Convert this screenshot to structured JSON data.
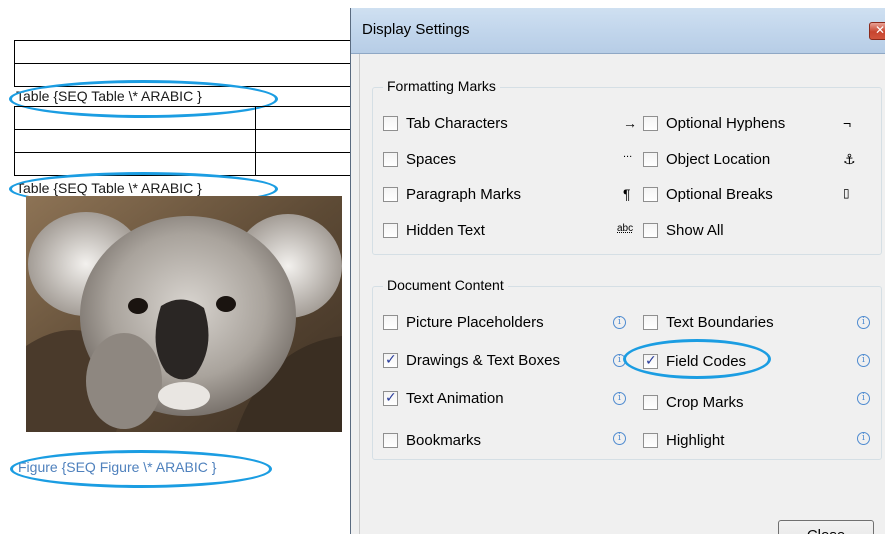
{
  "document": {
    "captions": {
      "table1": "Table {SEQ Table \\* ARABIC }",
      "table2": "Table {SEQ Table \\* ARABIC }",
      "figure": "Figure {SEQ Figure \\* ARABIC }"
    }
  },
  "dialog": {
    "title": "Display Settings",
    "formatting_marks": {
      "label": "Formatting Marks",
      "items": [
        {
          "label": "Tab Characters",
          "symbol": "→",
          "checked": false
        },
        {
          "label": "Optional Hyphens",
          "symbol": "¬",
          "checked": false
        },
        {
          "label": "Spaces",
          "symbol": "...",
          "checked": false
        },
        {
          "label": "Object Location",
          "symbol": "⚓",
          "checked": false
        },
        {
          "label": "Paragraph Marks",
          "symbol": "¶",
          "checked": false
        },
        {
          "label": "Optional Breaks",
          "symbol": "▯",
          "checked": false
        },
        {
          "label": "Hidden Text",
          "symbol": "abc",
          "checked": false
        },
        {
          "label": "Show All",
          "symbol": "",
          "checked": false
        }
      ]
    },
    "document_content": {
      "label": "Document Content",
      "items": [
        {
          "label": "Picture Placeholders",
          "checked": false
        },
        {
          "label": "Text Boundaries",
          "checked": false
        },
        {
          "label": "Drawings & Text Boxes",
          "checked": true
        },
        {
          "label": "Field Codes",
          "checked": true
        },
        {
          "label": "Text Animation",
          "checked": true
        },
        {
          "label": "Crop Marks",
          "checked": false
        },
        {
          "label": "Bookmarks",
          "checked": false
        },
        {
          "label": "Highlight",
          "checked": false
        }
      ]
    },
    "close_label": "Close",
    "info_glyph": "i"
  },
  "colors": {
    "highlight_ellipse": "#1b9de2",
    "figure_caption": "#4f81bd",
    "titlebar": "#c2d6ec"
  }
}
